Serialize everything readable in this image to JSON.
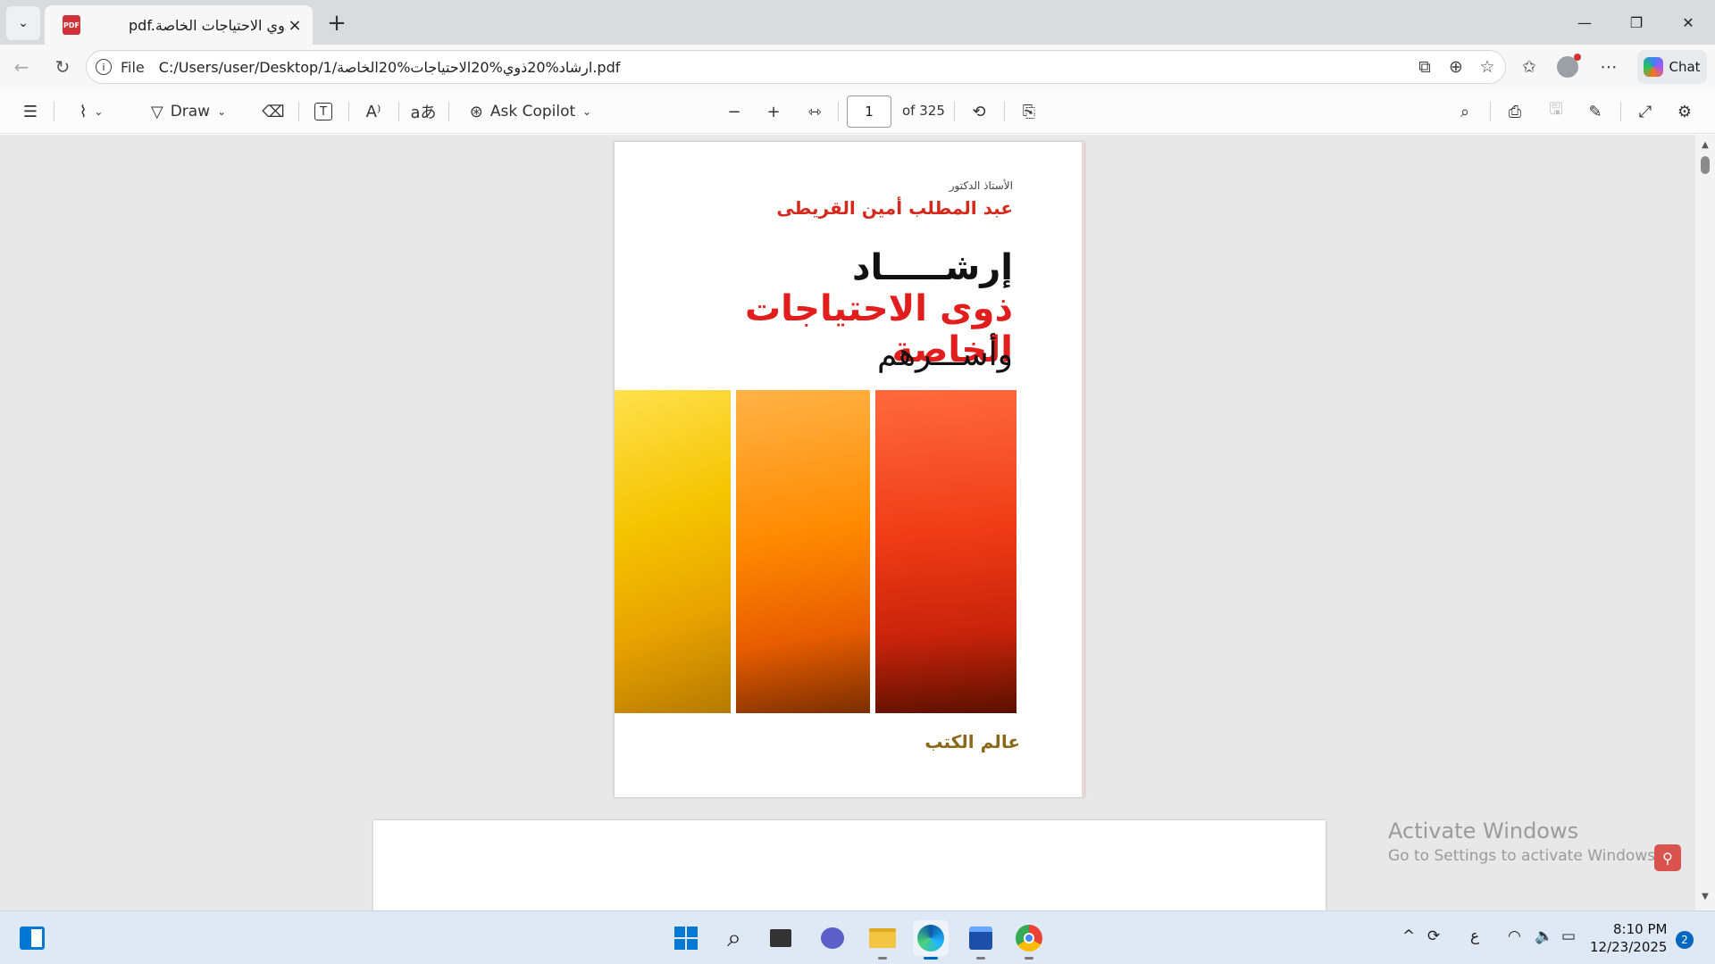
{
  "tab": {
    "title": "pdf.ارشاد ذوي الاحتياجات الخاصة",
    "pdf_icon": "PDF"
  },
  "window_controls": {
    "minimize": "—",
    "restore": "❐",
    "close": "✕"
  },
  "address": {
    "scheme": "File",
    "url": "C:/Users/user/Desktop/1/ارشاد%20ذوي%20الاحتياجات%20الخاصة.pdf"
  },
  "chat": {
    "label": "Chat"
  },
  "toolbar": {
    "draw_label": "Draw",
    "ask_copilot_label": "Ask Copilot",
    "page_current": "1",
    "page_total": "of 325"
  },
  "cover": {
    "author_label": "الأستاذ الدكتور",
    "author": "عبد المطلب أمين القريطى",
    "title_line1": "إرشـــــاد",
    "title_line2": "ذوى الاحتياجات الخاصة",
    "title_line3": "وأســـرهم",
    "publisher": "عالم الكتب"
  },
  "watermark": {
    "line1": "Activate Windows",
    "line2": "Go to Settings to activate Windows."
  },
  "tray": {
    "language": "ع"
  },
  "clock": {
    "time": "8:10 PM",
    "date": "12/23/2025"
  },
  "notifications": {
    "count": "2"
  },
  "colors": {
    "accent": "#0067c0",
    "title_red": "#e11d1d",
    "pdf_red": "#d13438"
  }
}
